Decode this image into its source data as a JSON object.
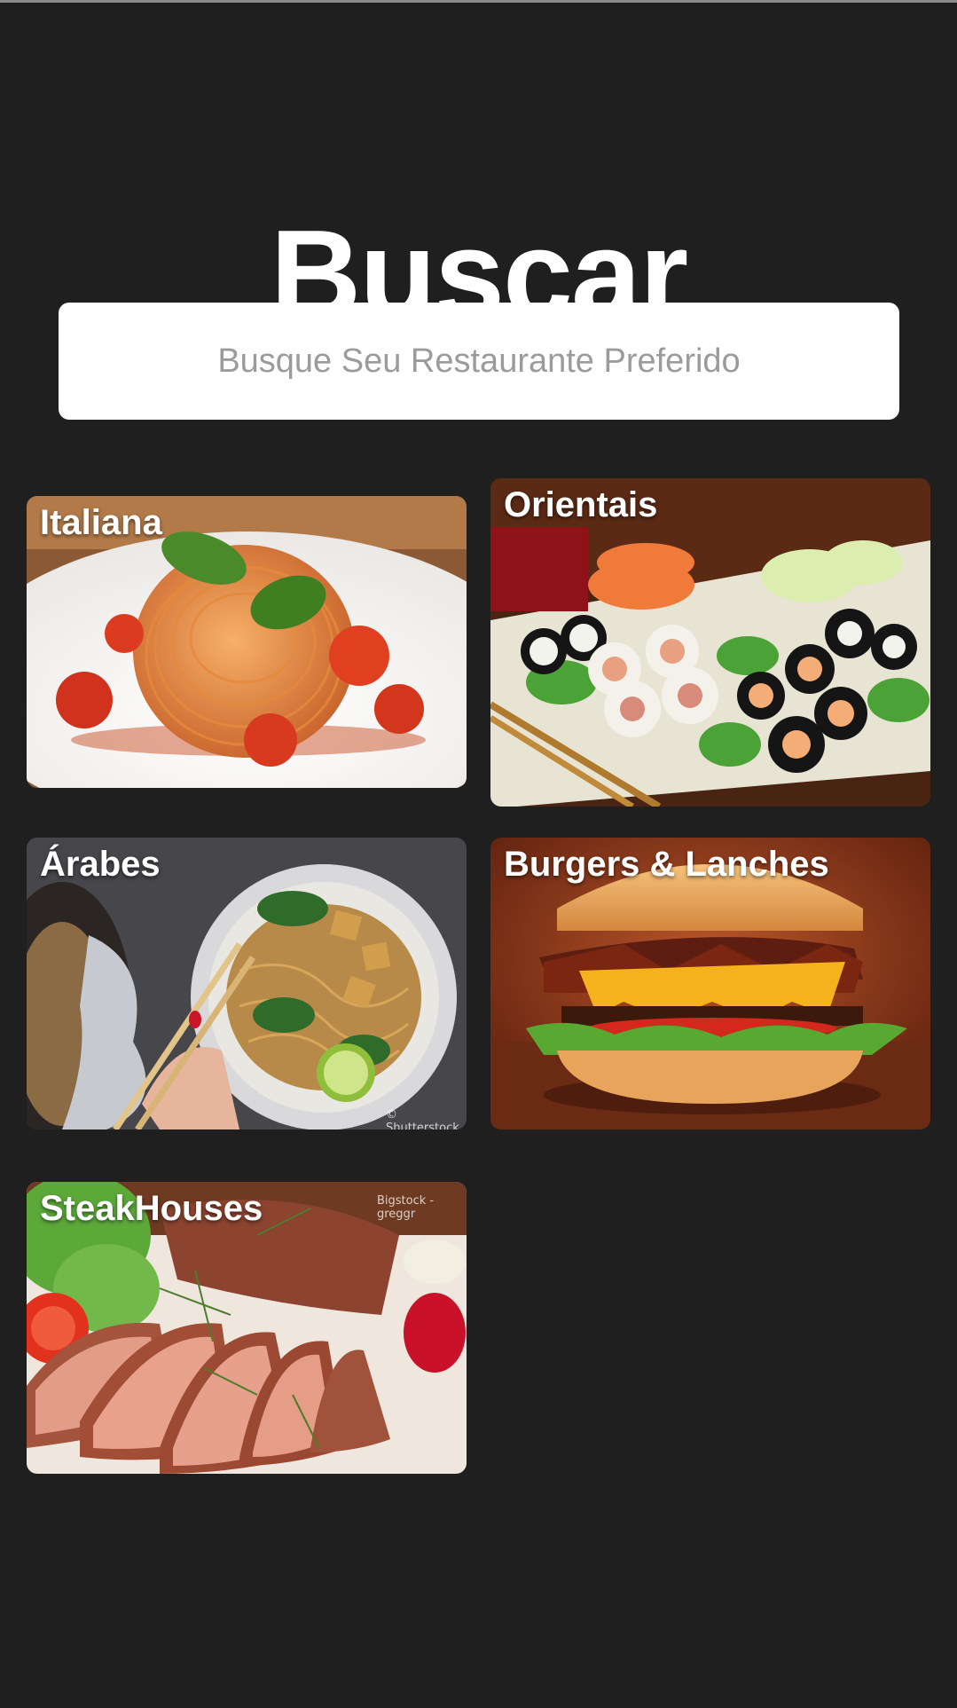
{
  "header": {
    "title": "Buscar"
  },
  "search": {
    "placeholder": "Busque Seu Restaurante Preferido",
    "value": ""
  },
  "categories": [
    {
      "label": "Italiana",
      "image": "pasta-photo"
    },
    {
      "label": "Orientais",
      "image": "sushi-photo"
    },
    {
      "label": "Árabes",
      "image": "noodles-bowl-photo",
      "watermark": "© Shutterstock"
    },
    {
      "label": "Burgers & Lanches",
      "image": "burger-photo"
    },
    {
      "label": "SteakHouses",
      "image": "steak-photo",
      "watermark": "Bigstock - greggr"
    }
  ],
  "colors": {
    "background": "#1f1f1f",
    "search_bg": "#ffffff",
    "placeholder": "#9b9b9b",
    "text": "#ffffff"
  }
}
